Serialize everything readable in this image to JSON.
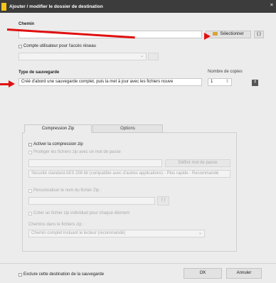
{
  "window": {
    "title": "Ajouter / modifier le dossier de destination",
    "close_glyph": "×"
  },
  "chemin": {
    "label": "Chemin",
    "value": "",
    "browse_label": "Sélectionner",
    "braces_label": "{ }"
  },
  "network": {
    "checkbox_label": "Compte utilisateur pour l'accès réseau",
    "user_value": ""
  },
  "backup_type": {
    "label": "Type de sauvegarde",
    "selected": "Créé d'abord une sauvegarde complet, puis la met à jour avec les fichiers nouve",
    "chevron": "⌄"
  },
  "copies": {
    "label": "Nombre de copies",
    "value": "1",
    "spin": "⇕"
  },
  "help_label": "?",
  "tabs": [
    {
      "label": "Compression Zip",
      "active": true
    },
    {
      "label": "Options",
      "active": false
    }
  ],
  "zip": {
    "activate_label": "Activer la compression zip",
    "protect_label": "Protéger les fichiers zip avec un mot de passe",
    "password_value": "",
    "password_button": "Définir mot de passe",
    "security_selected": "Sécurité standard AES 256 bit (compatible avec d'autres applications) - Plus rapide - Recommandé",
    "custom_name_label": "Personnaliser le nom du fichier Zip :",
    "custom_name_value": "",
    "custom_name_button": "{ }",
    "individual_label": "Créer un fichier zip individuel pour chaque élément",
    "paths_label": "Chemins dans le fichiers zip :",
    "paths_selected": "Chemin complet incluant le lecteur (recommandé)"
  },
  "footer": {
    "exclude_label": "Exclure cette destination de la sauvegarde",
    "ok_label": "OK",
    "cancel_label": "Annuler"
  },
  "colors": {
    "annotation_arrow": "#e01010",
    "title_bar": "#3c3c3c",
    "highlight_button": "#f5c518"
  }
}
